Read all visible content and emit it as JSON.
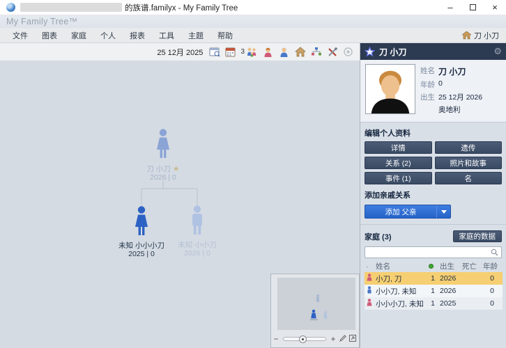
{
  "window": {
    "title": "的族谱.familyx - My Family Tree",
    "minimize_glyph": "–",
    "close_glyph": "×"
  },
  "brand": "My Family Tree™",
  "menu": {
    "items": [
      "文件",
      "图表",
      "家庭",
      "个人",
      "报表",
      "工具",
      "主题",
      "帮助"
    ],
    "home_person": "刀 小刀"
  },
  "toolbar": {
    "date": "25 12月 2025",
    "family_count": "3"
  },
  "tree": {
    "root": {
      "name": "刀 小刀",
      "star": "★",
      "detail": "2026 | 0"
    },
    "child_left": {
      "name": "未知 小小小刀",
      "detail": "2025 | 0"
    },
    "child_right": {
      "name": "未知 小小刀",
      "detail": "2026 | 0"
    }
  },
  "minimap": {
    "zoom_out": "−",
    "zoom_in": "+"
  },
  "sidebar": {
    "person_name": "刀 小刀",
    "gear_glyph": "⚙",
    "profile": {
      "name_label": "姓名",
      "name_value": "刀 小刀",
      "age_label": "年龄",
      "age_value": "0",
      "birth_label": "出生",
      "birth_value": "25 12月 2026",
      "place_value": "奥地利"
    },
    "edit_title": "编辑个人资料",
    "edit_buttons": [
      "详情",
      "遗传",
      "关系 (2)",
      "照片和故事",
      "事件 (1)",
      "名"
    ],
    "add_title": "添加亲戚关系",
    "add_button": "添加 父亲",
    "family_title": "家庭 (3)",
    "family_data_button": "家庭的数据",
    "search_placeholder": "",
    "table": {
      "col_name": "姓名",
      "col_birth": "出生",
      "col_death": "死亡",
      "col_age": "年龄",
      "rows": [
        {
          "name": "小刀, 刀",
          "marker": "1",
          "birth": "2026",
          "death": "",
          "age": "0"
        },
        {
          "name": "小小刀, 未知",
          "marker": "1",
          "birth": "2026",
          "death": "",
          "age": "0"
        },
        {
          "name": "小小小刀, 未知",
          "marker": "1",
          "birth": "2025",
          "death": "",
          "age": "0"
        }
      ]
    }
  },
  "colors": {
    "accent_blue": "#2a6bd4",
    "navy": "#2c3a52",
    "selection_gold": "#f6cf72",
    "male_blue": "#4a78c8",
    "female_pink": "#cf5a78",
    "canvas": "#d4dbe3"
  }
}
